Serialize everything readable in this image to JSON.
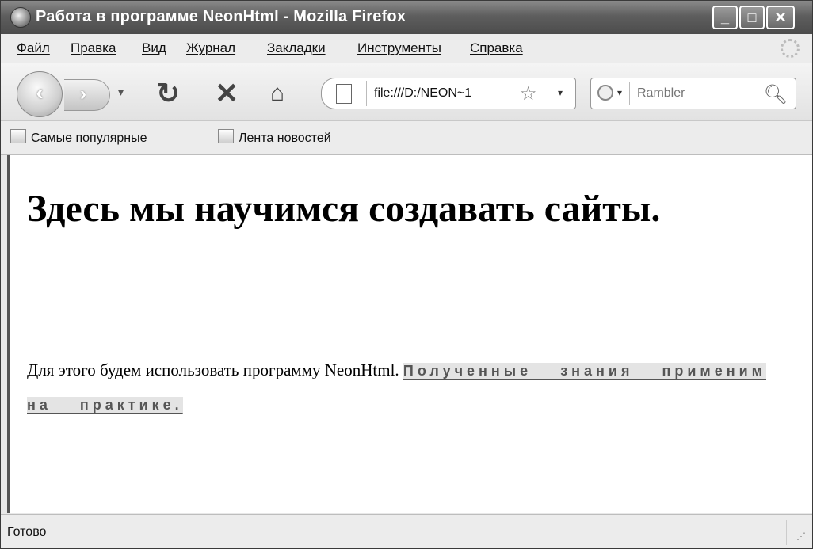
{
  "window": {
    "title": "Работа в программе NeonHtml - Mozilla Firefox",
    "controls": {
      "minimize": "_",
      "maximize": "□",
      "close": "✕"
    }
  },
  "menu": [
    "Файл",
    "Правка",
    "Вид",
    "Журнал",
    "Закладки",
    "Инструменты",
    "Справка"
  ],
  "toolbar": {
    "back_icon": "back-arrow-icon",
    "forward_icon": "forward-arrow-icon",
    "reload_icon": "reload-icon",
    "stop_icon": "stop-icon",
    "home_icon": "home-icon",
    "url": "file:///D:/NEON~1",
    "search_placeholder": "Rambler"
  },
  "bookmarks": [
    "Самые популярные",
    "Лента новостей"
  ],
  "page": {
    "heading": "Здесь мы научимся создавать сайты.",
    "paragraph_text": "Для этого будем использовать программу NeonHtml.",
    "highlighted_text": "Полученные знания применим на практике."
  },
  "status": {
    "text": "Готово"
  },
  "colors": {
    "titlebar": "#5e5e5e",
    "highlight_bg": "#e4e4e4",
    "highlight_text": "#555555"
  }
}
